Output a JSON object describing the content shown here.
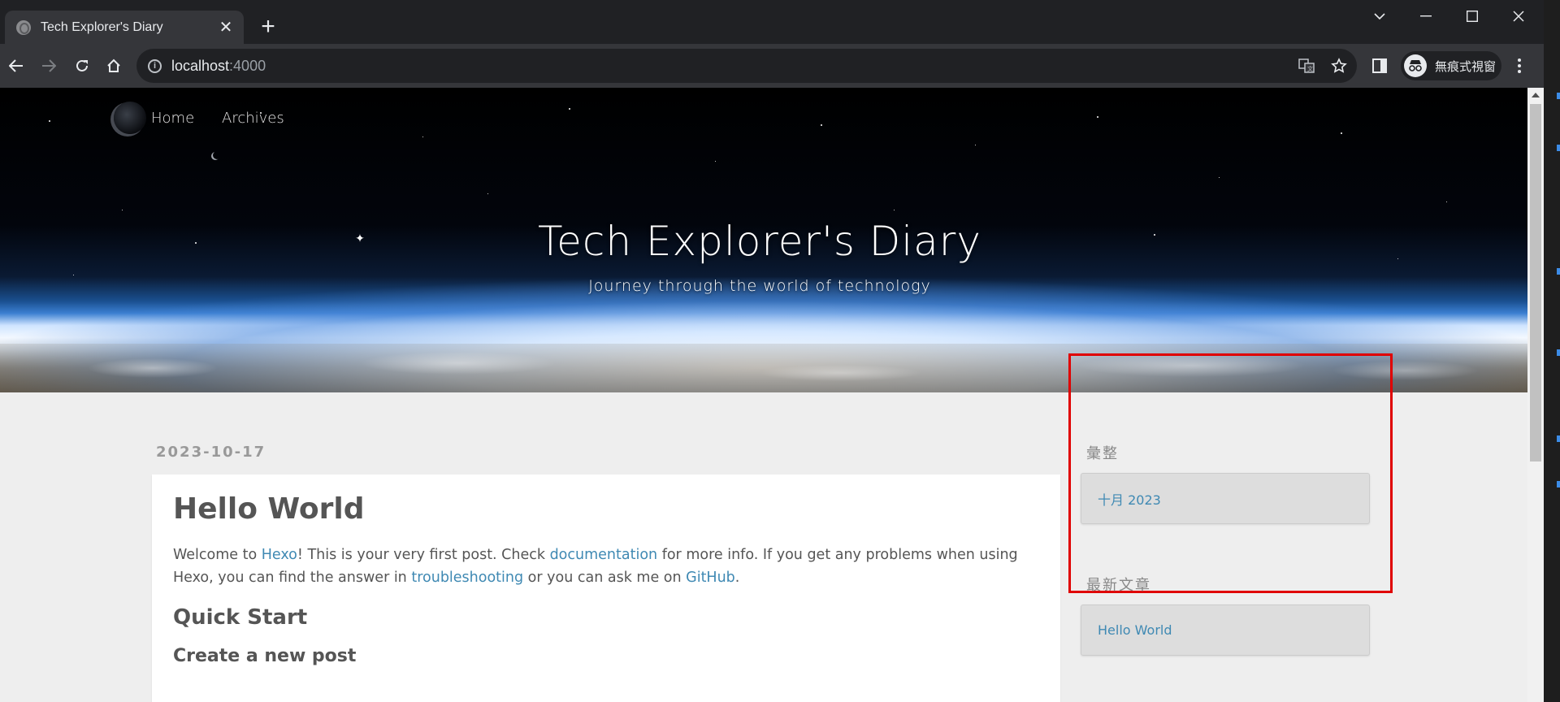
{
  "browser": {
    "tab_title": "Tech Explorer's Diary",
    "tab_close": "✕",
    "new_tab": "+",
    "url_host": "localhost",
    "url_port": ":4000",
    "profile_label": "無痕式視窗"
  },
  "site": {
    "nav": [
      {
        "label": "Home"
      },
      {
        "label": "Archives"
      }
    ],
    "title": "Tech Explorer's Diary",
    "subtitle": "Journey through the world of technology"
  },
  "post": {
    "date": "2023-10-17",
    "title": "Hello World",
    "p1_a": "Welcome to ",
    "p1_link1": "Hexo",
    "p1_b": "! This is your very first post. Check ",
    "p1_link2": "documentation",
    "p1_c": " for more info. If you get any problems when using Hexo, you can find the answer in ",
    "p1_link3": "troubleshooting",
    "p1_d": " or you can ask me on ",
    "p1_link4": "GitHub",
    "p1_e": ".",
    "h2": "Quick Start",
    "h3": "Create a new post"
  },
  "sidebar": {
    "archive_title": "彙整",
    "archive_item": "十月 2023",
    "recent_title": "最新文章",
    "recent_item": "Hello World"
  },
  "colors": {
    "link": "#3f89b3",
    "highlight": "#e00000",
    "page_bg": "#eeeeee"
  }
}
